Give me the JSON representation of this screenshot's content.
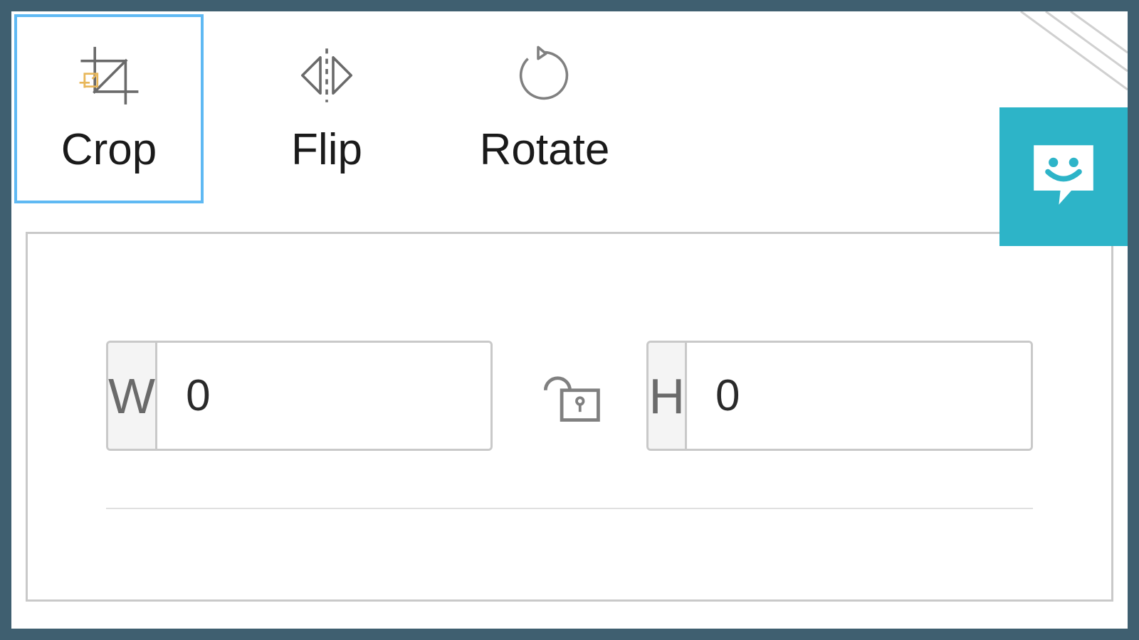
{
  "toolbar": {
    "tools": [
      {
        "id": "crop",
        "label": "Crop",
        "active": true
      },
      {
        "id": "flip",
        "label": "Flip",
        "active": false
      },
      {
        "id": "rotate",
        "label": "Rotate",
        "active": false
      }
    ]
  },
  "crop_panel": {
    "width_prefix": "W",
    "width_value": "0",
    "height_prefix": "H",
    "height_value": "0",
    "aspect_locked": false
  },
  "colors": {
    "accent": "#5fb9f3",
    "help_widget": "#2db4c8",
    "panel_border": "#c9c9c9",
    "app_bg": "#3f5f70"
  }
}
